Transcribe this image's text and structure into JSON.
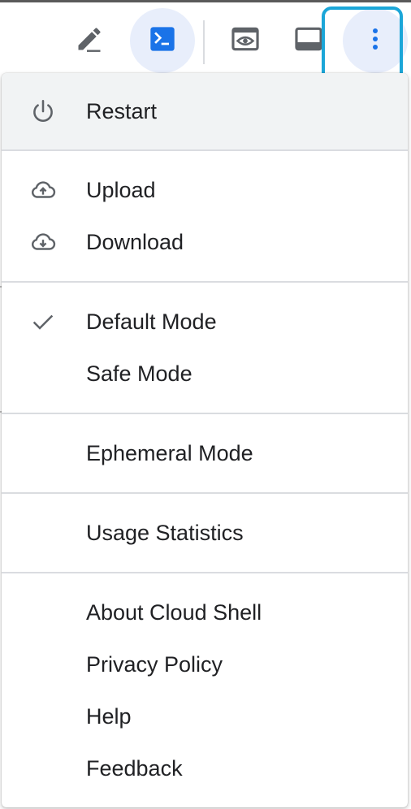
{
  "toolbar": {
    "buttons": [
      {
        "name": "open-editor-button",
        "icon": "pencil-icon"
      },
      {
        "name": "terminal-button",
        "icon": "terminal-icon",
        "active": true
      },
      {
        "name": "web-preview-button",
        "icon": "web-preview-icon"
      },
      {
        "name": "layout-button",
        "icon": "panel-layout-icon"
      },
      {
        "name": "more-options-button",
        "icon": "more-vert-icon"
      }
    ]
  },
  "menu": {
    "items": [
      {
        "label": "Restart",
        "icon": "power-icon"
      },
      {
        "label": "Upload",
        "icon": "cloud-upload-icon"
      },
      {
        "label": "Download",
        "icon": "cloud-download-icon"
      },
      {
        "label": "Default Mode",
        "icon": "check-icon",
        "checked": true
      },
      {
        "label": "Safe Mode"
      },
      {
        "label": "Ephemeral Mode"
      },
      {
        "label": "Usage Statistics"
      },
      {
        "label": "About Cloud Shell"
      },
      {
        "label": "Privacy Policy"
      },
      {
        "label": "Help"
      },
      {
        "label": "Feedback"
      }
    ]
  },
  "colors": {
    "accent_blue": "#1a73e8",
    "highlight_border": "#1ba6d8",
    "icon_gray": "#5f6368",
    "text": "#202124",
    "hover_bg": "#f1f3f4",
    "active_bg": "#e8eefb"
  }
}
